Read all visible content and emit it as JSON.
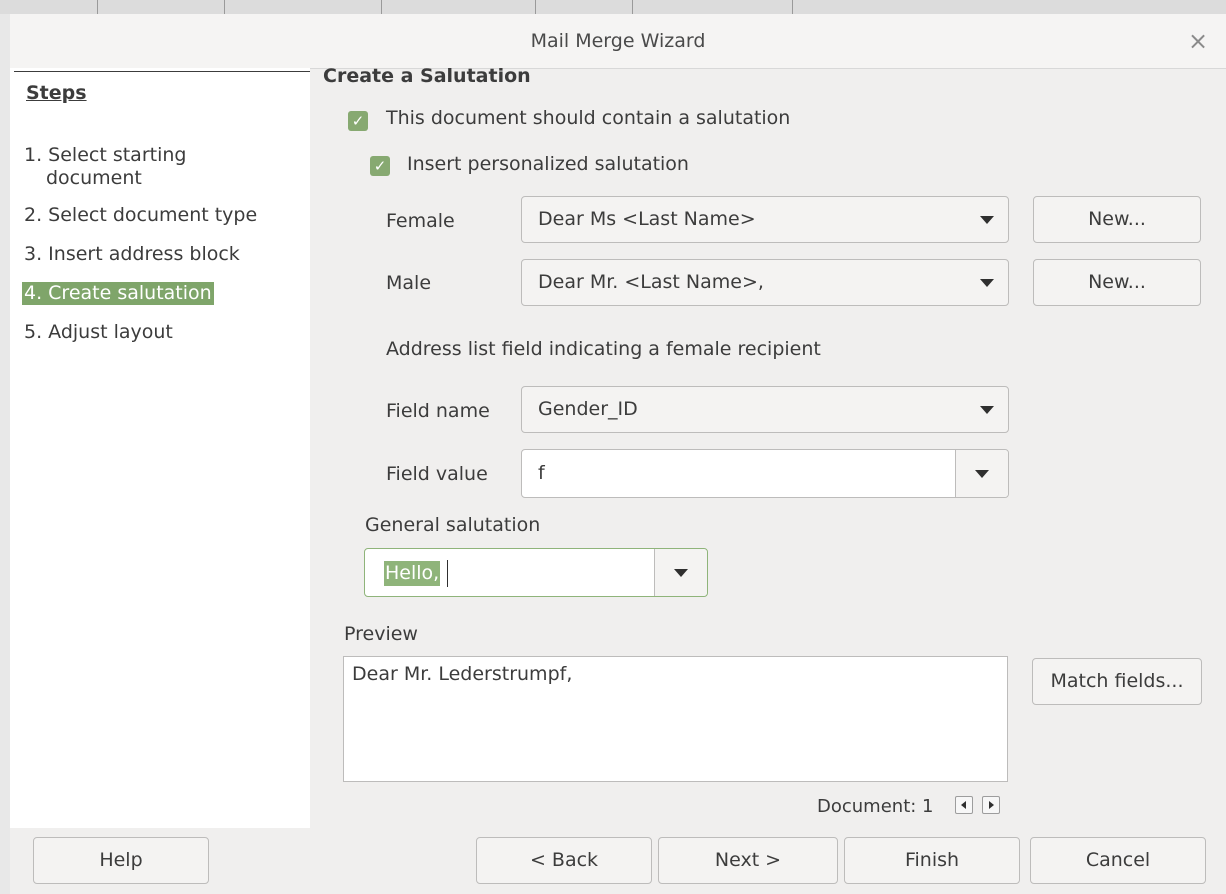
{
  "window": {
    "title": "Mail Merge Wizard",
    "close_glyph": "×"
  },
  "sidebar": {
    "heading": "Steps",
    "items": [
      {
        "label": "1. Select starting document",
        "line1": "1. Select starting",
        "line2": "document"
      },
      {
        "label": "2. Select document type"
      },
      {
        "label": "3. Insert address block"
      },
      {
        "label": "4. Create salutation",
        "active": true
      },
      {
        "label": "5. Adjust layout"
      }
    ]
  },
  "main": {
    "heading": "Create a Salutation",
    "contain_salutation": {
      "label": "This document should contain a salutation",
      "checked": true
    },
    "personalized": {
      "label": "Insert personalized salutation",
      "checked": true
    },
    "female": {
      "label": "Female",
      "value": "Dear Ms <Last Name>",
      "new_label": "New..."
    },
    "male": {
      "label": "Male",
      "value": "Dear Mr. <Last Name>,",
      "new_label": "New..."
    },
    "address_list_label": "Address list field indicating a female recipient",
    "field_name": {
      "label": "Field name",
      "value": "Gender_ID"
    },
    "field_value": {
      "label": "Field value",
      "value": "f"
    },
    "general": {
      "label": "General salutation",
      "value": "Hello,"
    },
    "preview": {
      "label": "Preview",
      "text": "Dear Mr. Lederstrumpf,",
      "match_label": "Match fields..."
    },
    "document_nav": {
      "label": "Document: 1",
      "prev_icon": "arrow-left-icon",
      "next_icon": "arrow-right-icon"
    }
  },
  "footer": {
    "help": "Help",
    "back": "< Back",
    "next": "Next >",
    "finish": "Finish",
    "cancel": "Cancel"
  },
  "colors": {
    "accent": "#87a971",
    "active_step": "#7fa56a",
    "selection": "#8fb47a"
  }
}
